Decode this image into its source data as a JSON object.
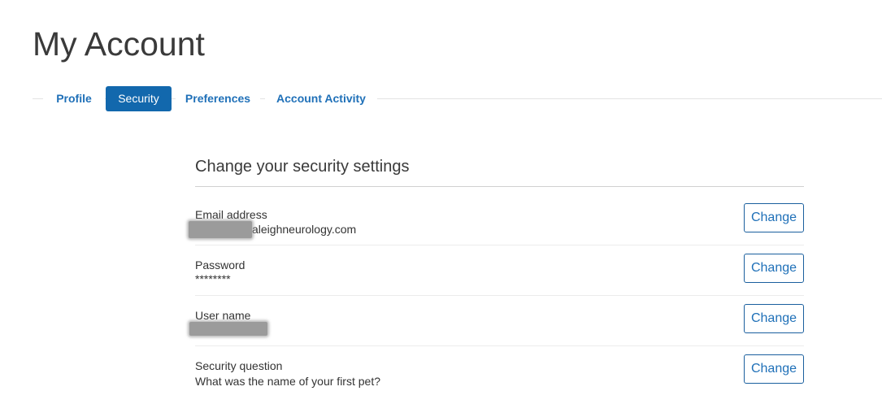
{
  "page": {
    "title": "My Account"
  },
  "tabs": [
    {
      "label": "Profile",
      "active": false
    },
    {
      "label": "Security",
      "active": true
    },
    {
      "label": "Preferences",
      "active": false
    },
    {
      "label": "Account Activity",
      "active": false
    }
  ],
  "security": {
    "heading": "Change your security settings",
    "change_label": "Change",
    "rows": [
      {
        "label": "Email address",
        "value": "aleighneurology.com",
        "redacted": true
      },
      {
        "label": "Password",
        "value": "********",
        "redacted": false
      },
      {
        "label": "User name",
        "value": "",
        "redacted": true
      },
      {
        "label": "Security question",
        "value": "What was the name of your first pet?",
        "redacted": false
      }
    ]
  },
  "colors": {
    "accent": "#1268ad",
    "link": "#1f70b8",
    "text": "#333333",
    "redaction": "#9b9b9b"
  }
}
